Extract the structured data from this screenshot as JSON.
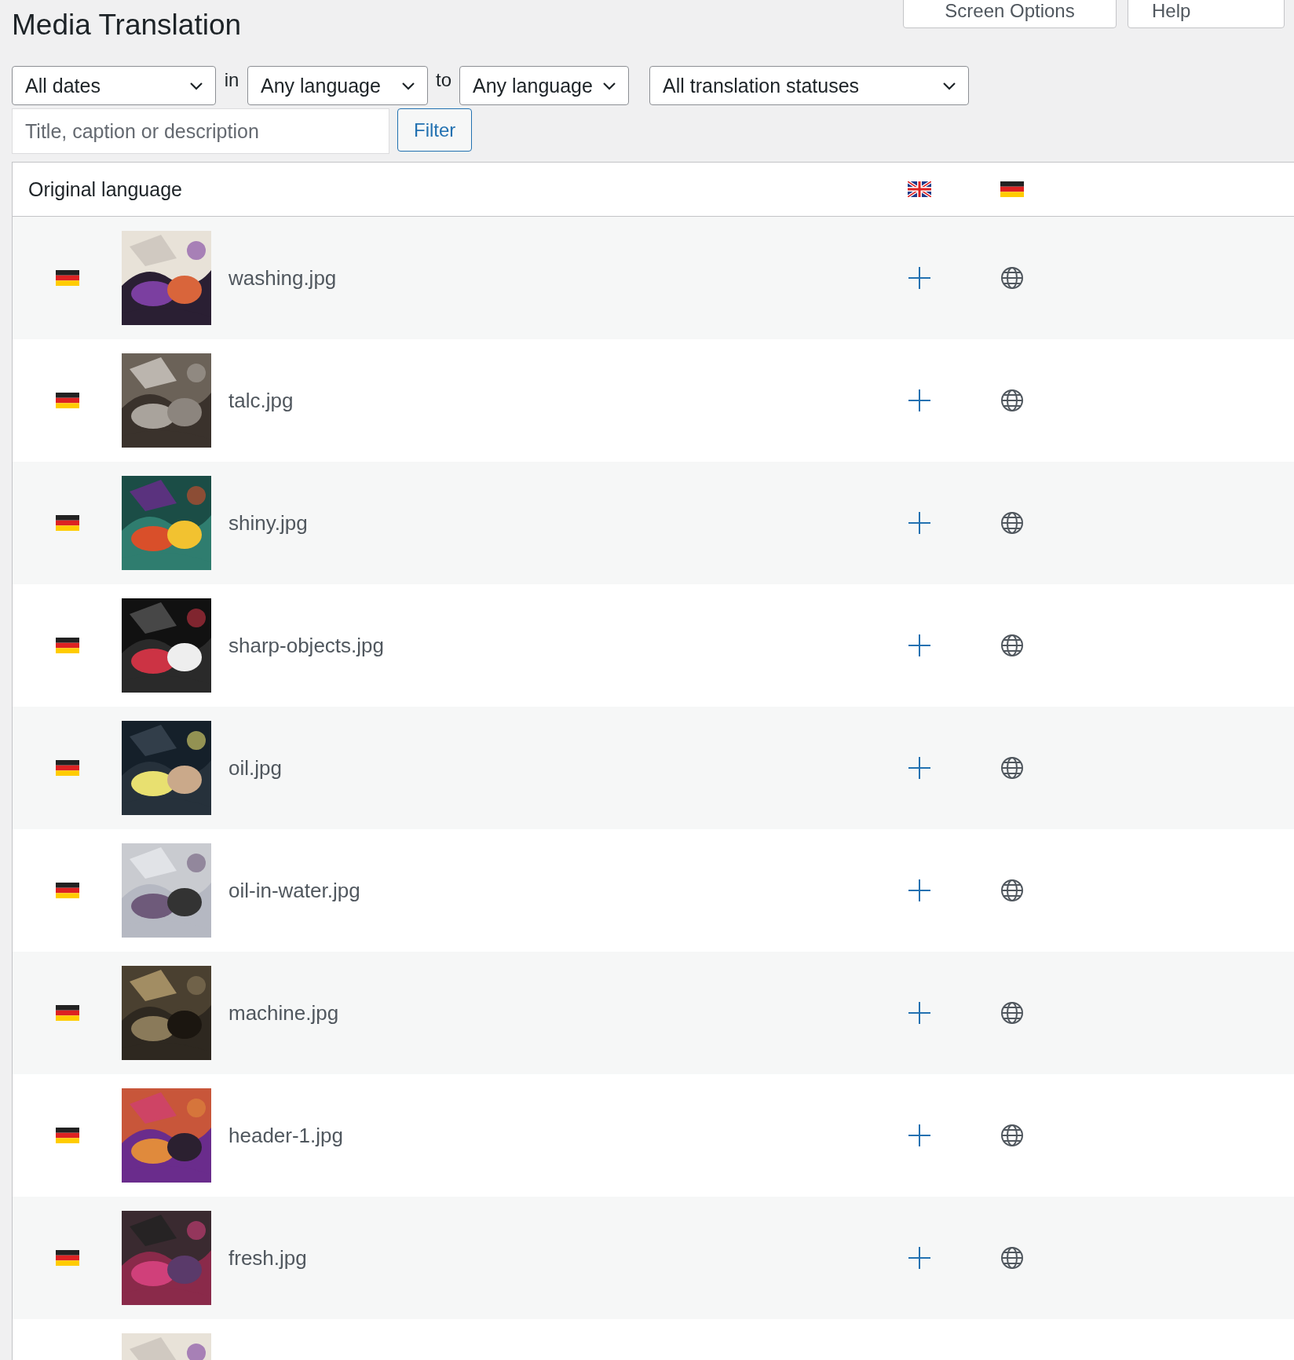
{
  "top_buttons": [
    {
      "label": "Screen Options"
    },
    {
      "label": "Help"
    }
  ],
  "title": "Media Translation",
  "filters": [
    {
      "kind": "select",
      "value": "All dates"
    },
    {
      "kind": "text",
      "value": "in"
    },
    {
      "kind": "select",
      "value": "Any language"
    },
    {
      "kind": "text",
      "value": "to"
    },
    {
      "kind": "select",
      "value": "Any language"
    },
    {
      "kind": "select",
      "value": "All translation statuses"
    }
  ],
  "search": {
    "placeholder": "Title, caption or description"
  },
  "filter_button": "Filter",
  "table": {
    "header": {
      "label": "Original language",
      "languages": [
        {
          "kind": "uk"
        },
        {
          "kind": "de"
        }
      ]
    },
    "rows": [
      {
        "kind": "file",
        "original": {
          "kind": "de"
        },
        "name": "washing.jpg",
        "actions": [
          {
            "kind": "add"
          },
          {
            "kind": "globe"
          }
        ]
      },
      {
        "kind": "file",
        "original": {
          "kind": "de"
        },
        "name": "talc.jpg",
        "actions": [
          {
            "kind": "add"
          },
          {
            "kind": "globe"
          }
        ]
      },
      {
        "kind": "file",
        "original": {
          "kind": "de"
        },
        "name": "shiny.jpg",
        "actions": [
          {
            "kind": "add"
          },
          {
            "kind": "globe"
          }
        ]
      },
      {
        "kind": "file",
        "original": {
          "kind": "de"
        },
        "name": "sharp-objects.jpg",
        "actions": [
          {
            "kind": "add"
          },
          {
            "kind": "globe"
          }
        ]
      },
      {
        "kind": "file",
        "original": {
          "kind": "de"
        },
        "name": "oil.jpg",
        "actions": [
          {
            "kind": "add"
          },
          {
            "kind": "globe"
          }
        ]
      },
      {
        "kind": "file",
        "original": {
          "kind": "de"
        },
        "name": "oil-in-water.jpg",
        "actions": [
          {
            "kind": "add"
          },
          {
            "kind": "globe"
          }
        ]
      },
      {
        "kind": "file",
        "original": {
          "kind": "de"
        },
        "name": "machine.jpg",
        "actions": [
          {
            "kind": "add"
          },
          {
            "kind": "globe"
          }
        ]
      },
      {
        "kind": "file",
        "original": {
          "kind": "de"
        },
        "name": "header-1.jpg",
        "actions": [
          {
            "kind": "add"
          },
          {
            "kind": "globe"
          }
        ]
      },
      {
        "kind": "file",
        "original": {
          "kind": "de"
        },
        "name": "fresh.jpg",
        "actions": [
          {
            "kind": "add"
          },
          {
            "kind": "globe"
          }
        ]
      },
      {
        "kind": "partial"
      }
    ]
  }
}
